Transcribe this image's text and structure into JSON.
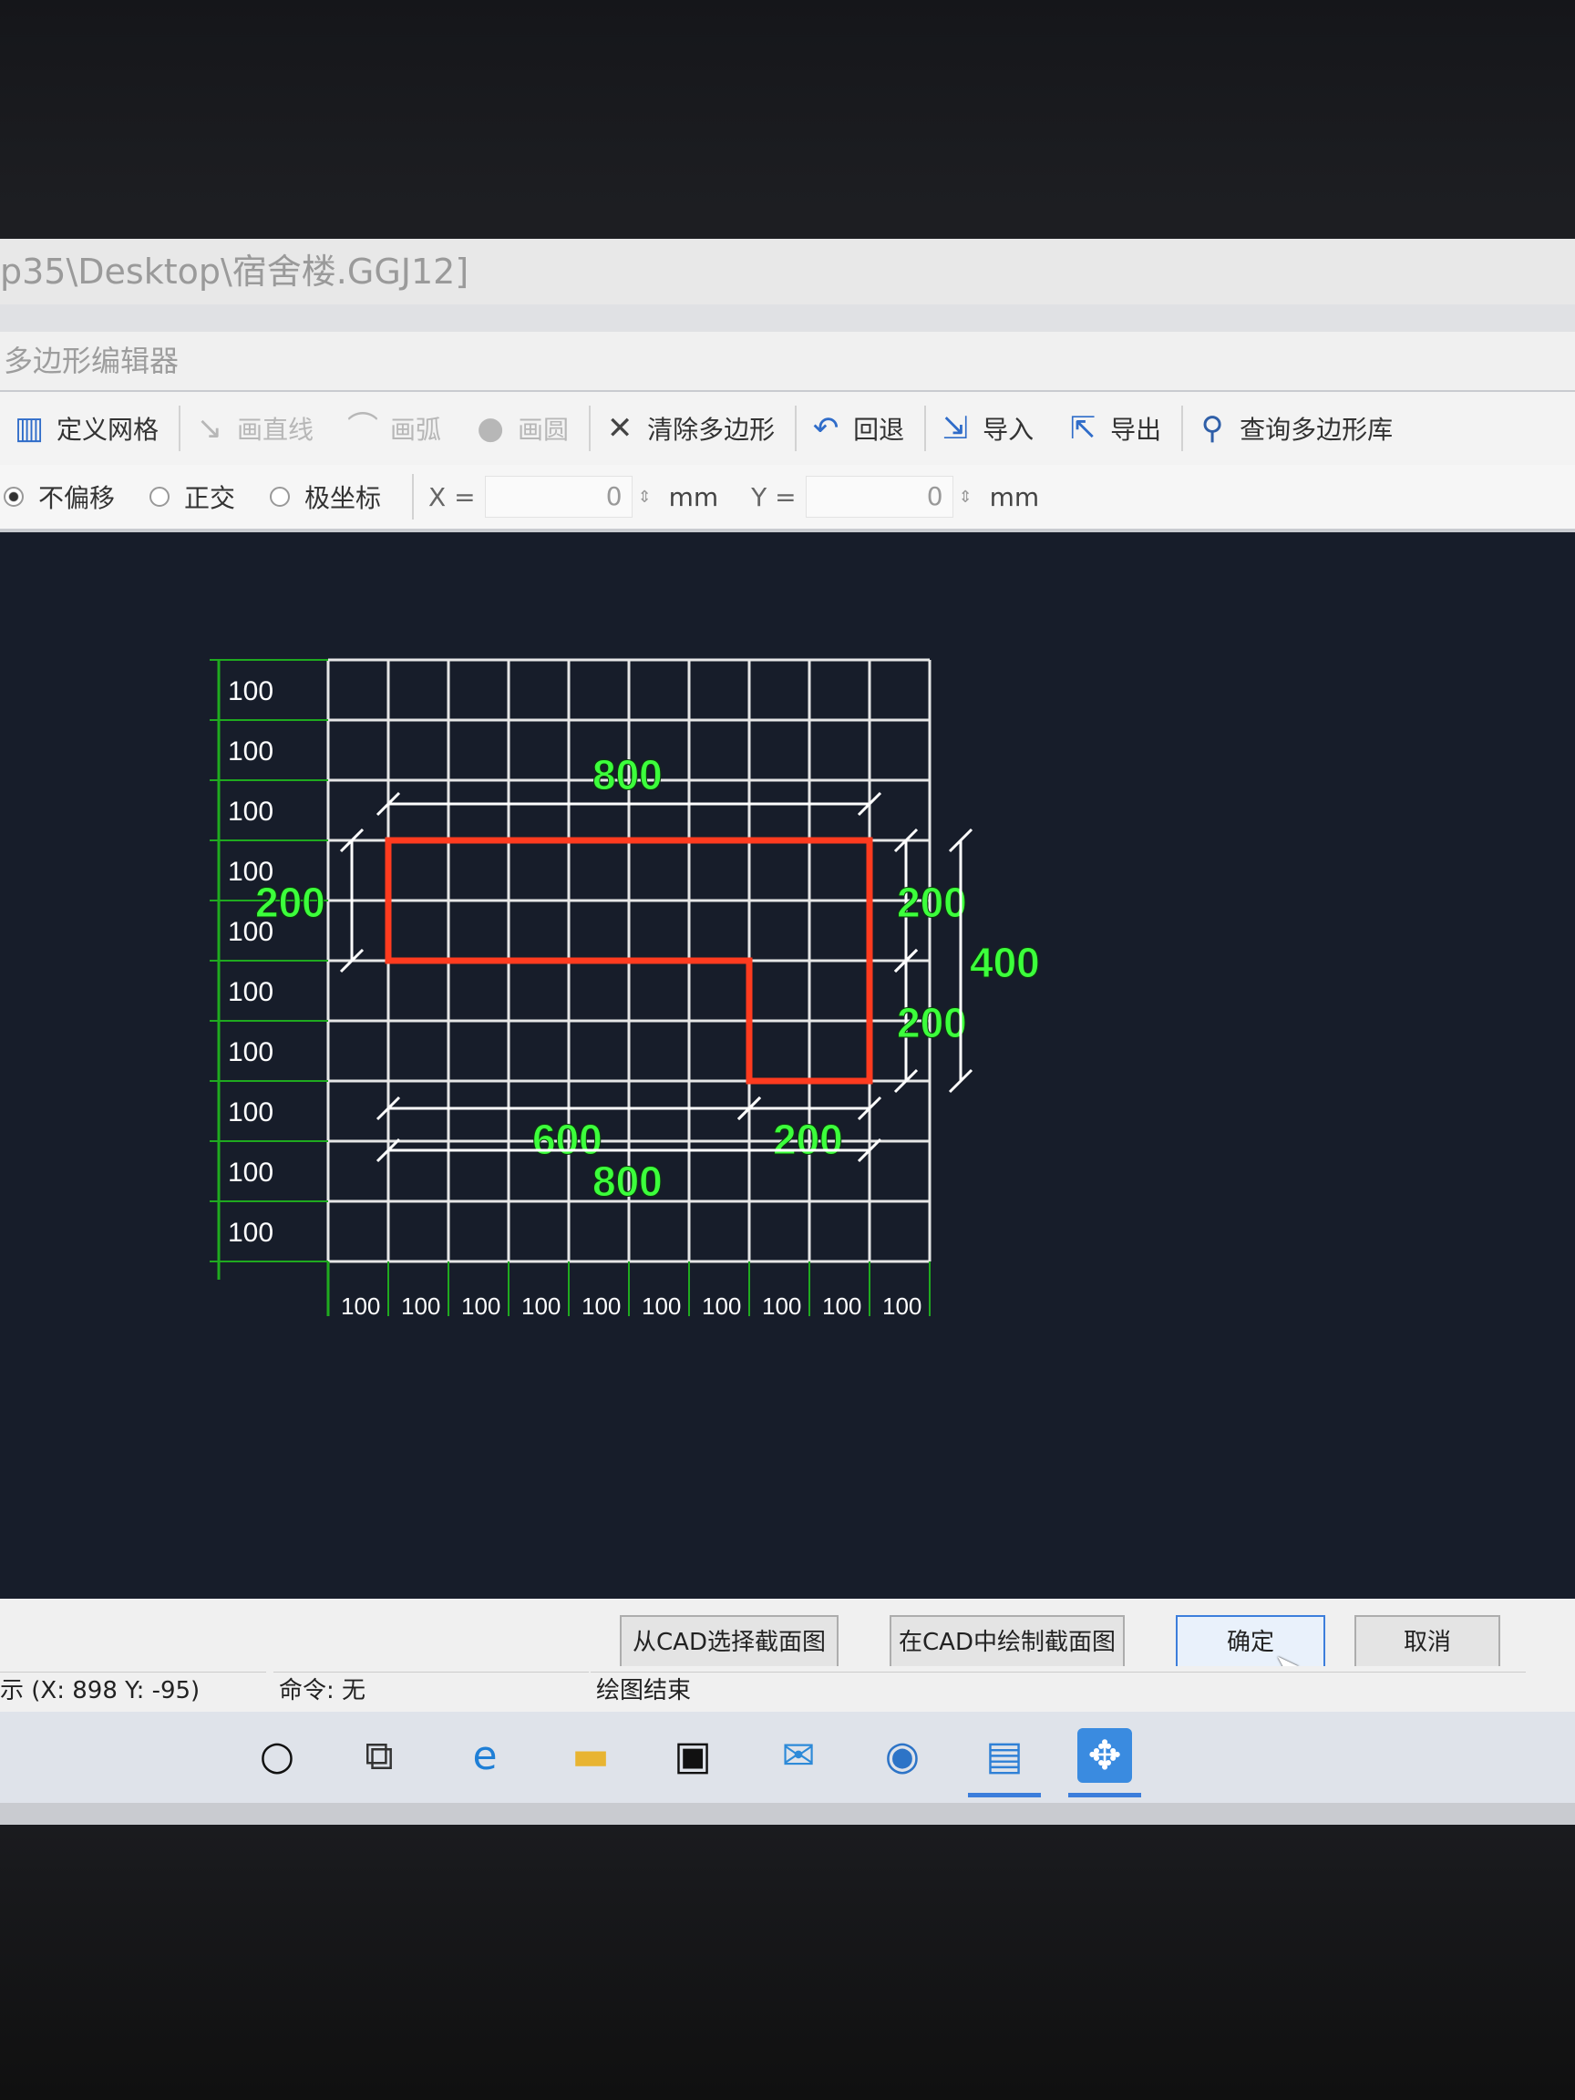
{
  "window": {
    "title": "p35\\Desktop\\宿舍楼.GGJ12]",
    "dialog_title": "多边形编辑器"
  },
  "toolbar": {
    "define_grid": "定义网格",
    "draw_line": "画直线",
    "draw_arc": "画弧",
    "draw_circle": "画圆",
    "clear_polygon": "清除多边形",
    "undo": "回退",
    "import": "导入",
    "export": "导出",
    "query_library": "查询多边形库"
  },
  "options": {
    "no_offset": "不偏移",
    "ortho": "正交",
    "polar": "极坐标",
    "x_label": "X =",
    "x_value": "0",
    "x_unit": "mm",
    "y_label": "Y =",
    "y_value": "0",
    "y_unit": "mm",
    "selected": "不偏移"
  },
  "grid": {
    "row_spacings": [
      "100",
      "100",
      "100",
      "100",
      "100",
      "100",
      "100",
      "100",
      "100",
      "100"
    ],
    "col_spacings": [
      "100",
      "100",
      "100",
      "100",
      "100",
      "100",
      "100",
      "100",
      "100",
      "100"
    ],
    "dimensions": {
      "top": "800",
      "left": "200",
      "right_upper": "200",
      "right_lower": "200",
      "right_total": "400",
      "bottom_left": "600",
      "bottom_right": "200",
      "bottom_total": "800"
    },
    "polygon_color": "#ff3b1f",
    "dimension_color": "#3cff3c",
    "grid_color": "#e6e6e6"
  },
  "buttons": {
    "select_from_cad": "从CAD选择截面图",
    "draw_in_cad": "在CAD中绘制截面图",
    "ok": "确定",
    "cancel": "取消"
  },
  "status": {
    "coords": "示 (X: 898 Y: -95)",
    "command": "命令: 无",
    "message": "绘图结束"
  },
  "taskbar": {
    "icons": [
      "cortana-icon",
      "task-view-icon",
      "edge-icon",
      "file-explorer-icon",
      "store-icon",
      "mail-icon",
      "app-icon",
      "glodon-icon",
      "glodon-polygon-icon"
    ]
  }
}
